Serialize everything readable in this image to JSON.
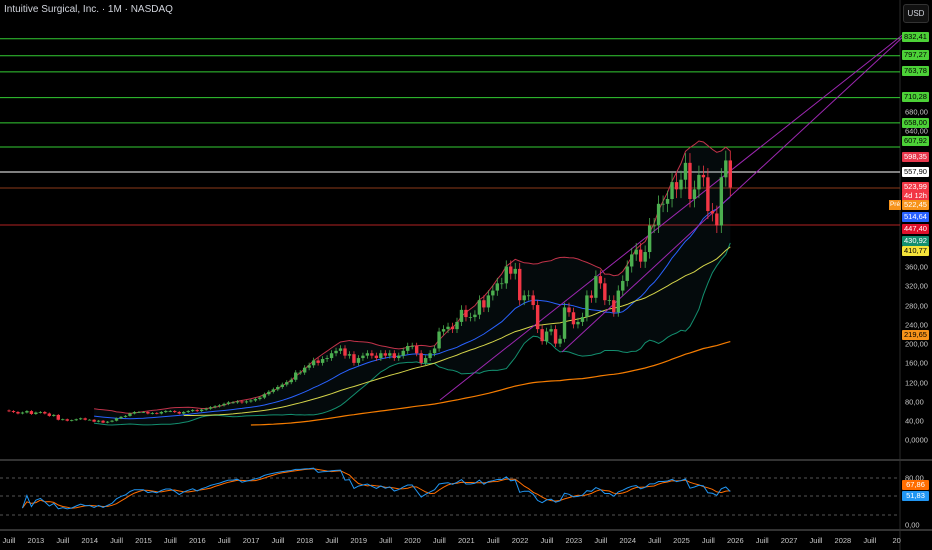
{
  "header": {
    "title": "Intuitive Surgical, Inc. · 1M · NASDAQ",
    "currency": "USD"
  },
  "colors": {
    "up": "#26a69a",
    "up_body": "#4caf50",
    "down": "#f23645",
    "bg": "#000000",
    "level_green": "#33cc33",
    "level_red": "#b22222",
    "bb_upper": "#c2334a",
    "bb_basis": "#2962ff",
    "bb_lower": "#138f6f",
    "ma50": "#d4d44a",
    "ma200": "#f57c00",
    "channel": "#9c27b0",
    "rsi": "#2196f3",
    "rsi_signal": "#ff6d00"
  },
  "price_axis": [
    "680,00",
    "640,00",
    "360,00",
    "320,00",
    "280,00",
    "240,00",
    "200,00",
    "160,00",
    "120,00",
    "80,00",
    "40,00",
    "0,0000"
  ],
  "rsi_axis": [
    "80,00",
    "40,00",
    "0,00"
  ],
  "time_axis": [
    "Juill",
    "2013",
    "Juill",
    "2014",
    "Juill",
    "2015",
    "Juill",
    "2016",
    "Juill",
    "2017",
    "Juill",
    "2018",
    "Juill",
    "2019",
    "Juill",
    "2020",
    "Juill",
    "2021",
    "Juill",
    "2022",
    "Juill",
    "2023",
    "Juill",
    "2024",
    "Juill",
    "2025",
    "Juill",
    "2026",
    "Juill",
    "2027",
    "Juill",
    "2028",
    "Juill",
    "20"
  ],
  "levels": {
    "green": [
      832.41,
      797.27,
      763.78,
      710.28,
      658.0,
      607.92
    ],
    "white": 557.9,
    "brown": 523.99,
    "red": 447.4
  },
  "badges": [
    {
      "text": "832,41",
      "bg": "#4cd137",
      "fg": "#000"
    },
    {
      "text": "797,27",
      "bg": "#4cd137",
      "fg": "#000"
    },
    {
      "text": "763,78",
      "bg": "#4cd137",
      "fg": "#000"
    },
    {
      "text": "710,28",
      "bg": "#4cd137",
      "fg": "#000"
    },
    {
      "text": "658,00",
      "bg": "#4cd137",
      "fg": "#000"
    },
    {
      "text": "607,92",
      "bg": "#4cd137",
      "fg": "#000"
    },
    {
      "text": "598,35",
      "bg": "#e8364c",
      "fg": "#fff"
    },
    {
      "text": "557,90",
      "bg": "#ffffff",
      "fg": "#000"
    },
    {
      "text": "523,99",
      "bg": "#f23645",
      "fg": "#fff"
    },
    {
      "text": "4d 12h",
      "bg": "#f23645",
      "fg": "#fff"
    },
    {
      "text": "522,45",
      "bg": "#f7931a",
      "fg": "#fff"
    },
    {
      "text": "514,64",
      "bg": "#2962ff",
      "fg": "#fff"
    },
    {
      "text": "447,40",
      "bg": "#e0102c",
      "fg": "#fff"
    },
    {
      "text": "430,92",
      "bg": "#138f6f",
      "fg": "#fff"
    },
    {
      "text": "410,77",
      "bg": "#f5e33a",
      "fg": "#000"
    },
    {
      "text": "219,65",
      "bg": "#f7931a",
      "fg": "#000"
    },
    {
      "text": "67,86",
      "bg": "#ff6d00",
      "fg": "#fff"
    },
    {
      "text": "51,83",
      "bg": "#2196f3",
      "fg": "#fff"
    }
  ],
  "pre_tag": "Pré",
  "chart_data": {
    "type": "candlestick",
    "title": "Intuitive Surgical, Inc. · 1M · NASDAQ",
    "start": "2012-07",
    "interval": "1M",
    "ylim": [
      0,
      860
    ],
    "closes": [
      60,
      58,
      55,
      57,
      60,
      54,
      57,
      58,
      55,
      50,
      52,
      42,
      43,
      40,
      41,
      43,
      45,
      42,
      42,
      38,
      40,
      36,
      38,
      40,
      45,
      48,
      50,
      55,
      58,
      58,
      58,
      55,
      56,
      55,
      58,
      60,
      60,
      58,
      55,
      58,
      60,
      62,
      60,
      63,
      65,
      68,
      70,
      72,
      75,
      78,
      78,
      80,
      78,
      80,
      82,
      85,
      88,
      95,
      100,
      105,
      110,
      115,
      120,
      125,
      140,
      140,
      150,
      155,
      165,
      160,
      168,
      170,
      180,
      185,
      190,
      175,
      178,
      160,
      170,
      175,
      180,
      175,
      170,
      180,
      175,
      180,
      170,
      175,
      185,
      195,
      195,
      180,
      160,
      170,
      180,
      190,
      225,
      230,
      235,
      230,
      245,
      270,
      255,
      255,
      260,
      290,
      275,
      300,
      310,
      325,
      325,
      360,
      345,
      355,
      290,
      300,
      300,
      280,
      230,
      205,
      225,
      230,
      200,
      210,
      275,
      265,
      240,
      245,
      255,
      300,
      295,
      340,
      325,
      290,
      290,
      265,
      310,
      330,
      360,
      385,
      395,
      370,
      390,
      445,
      445,
      490,
      490,
      500,
      535,
      520,
      540,
      575,
      500,
      520,
      550,
      545,
      475,
      470,
      445,
      545,
      580,
      524
    ],
    "indicators": [
      "Bollinger Bands (20)",
      "SMA 50",
      "SMA 200",
      "RSI (14)",
      "RSI signal"
    ]
  }
}
